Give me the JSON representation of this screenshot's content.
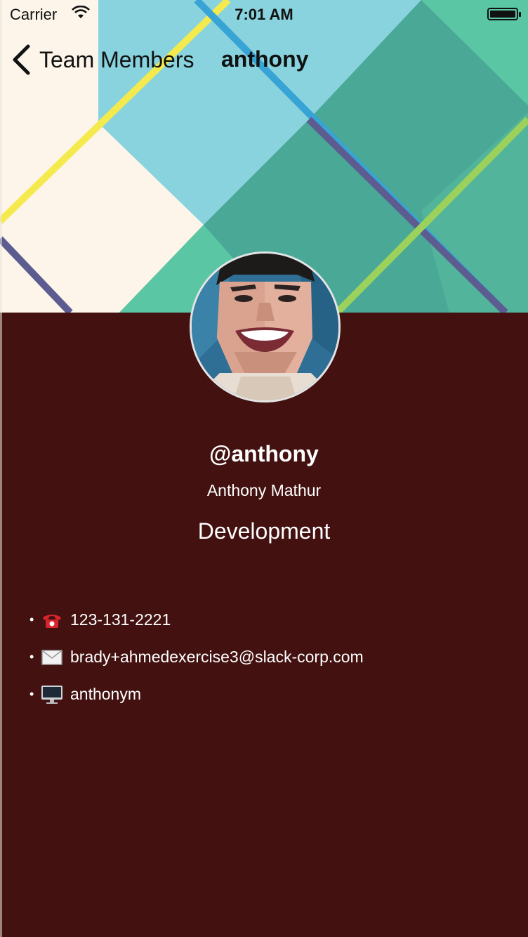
{
  "status_bar": {
    "carrier": "Carrier",
    "time": "7:01 AM"
  },
  "nav": {
    "back_label": "Team Members",
    "title": "anthony"
  },
  "profile": {
    "username": "@anthony",
    "full_name": "Anthony Mathur",
    "department": "Development"
  },
  "contacts": [
    {
      "icon": "telephone-icon",
      "value": "123-131-2221"
    },
    {
      "icon": "envelope-icon",
      "value": "brady+ahmedexercise3@slack-corp.com"
    },
    {
      "icon": "computer-icon",
      "value": "anthonym"
    }
  ],
  "colors": {
    "background": "#421110",
    "header_cream": "#fdf5e9",
    "header_blue": "#88d3de",
    "header_teal": "#4aa896",
    "header_green": "#5bc6a3",
    "stripe_yellow": "#f5ea4d",
    "stripe_navy": "#5c5c91",
    "stripe_blue": "#38a4d6",
    "stripe_lime": "#9cd25c"
  }
}
